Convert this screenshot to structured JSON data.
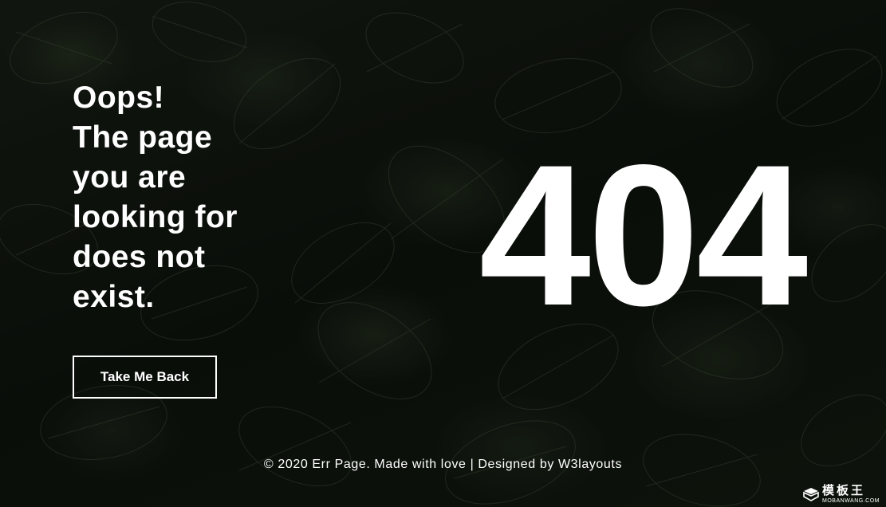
{
  "error": {
    "headline_lines": [
      "Oops!",
      "The page",
      "you are",
      "looking for",
      "does not",
      "exist."
    ],
    "code": "404",
    "back_button_label": "Take Me Back"
  },
  "footer": {
    "text": "© 2020 Err Page. Made with love | Designed by W3layouts"
  },
  "watermark": {
    "title": "模板王",
    "subtitle": "MOBANWANG.COM",
    "icon": "cube-logo-icon"
  },
  "colors": {
    "text": "#ffffff",
    "background": "#10160f",
    "leaf": "#2c3a28"
  }
}
